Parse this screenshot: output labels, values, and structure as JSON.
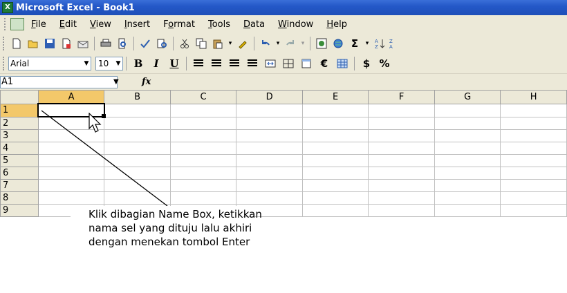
{
  "window": {
    "title": "Microsoft Excel - Book1"
  },
  "menu": {
    "items": [
      {
        "label": "File",
        "u": "F",
        "rest": "ile"
      },
      {
        "label": "Edit",
        "u": "E",
        "rest": "dit"
      },
      {
        "label": "View",
        "u": "V",
        "rest": "iew"
      },
      {
        "label": "Insert",
        "pre": "",
        "u": "I",
        "rest": "nsert"
      },
      {
        "label": "Format",
        "pre": "F",
        "u": "o",
        "rest": "rmat"
      },
      {
        "label": "Tools",
        "u": "T",
        "rest": "ools"
      },
      {
        "label": "Data",
        "u": "D",
        "rest": "ata"
      },
      {
        "label": "Window",
        "u": "W",
        "rest": "indow"
      },
      {
        "label": "Help",
        "u": "H",
        "rest": "elp"
      }
    ]
  },
  "format_toolbar": {
    "font": "Arial",
    "size": "10",
    "bold": "B",
    "italic": "I",
    "underline": "U",
    "euro": "€",
    "currency": "$",
    "percent": "%"
  },
  "standard_toolbar": {
    "sigma": "Σ"
  },
  "formula_bar": {
    "name_box": "A1",
    "fx": "fx"
  },
  "grid": {
    "columns": [
      "A",
      "B",
      "C",
      "D",
      "E",
      "F",
      "G",
      "H"
    ],
    "rows": [
      "1",
      "2",
      "3",
      "4",
      "5",
      "6",
      "7",
      "8",
      "9"
    ],
    "active_cell": "A1"
  },
  "annotation": {
    "lines": [
      "Klik dibagian Name Box, ketikkan",
      "nama sel yang dituju lalu akhiri",
      "dengan menekan tombol Enter"
    ]
  }
}
